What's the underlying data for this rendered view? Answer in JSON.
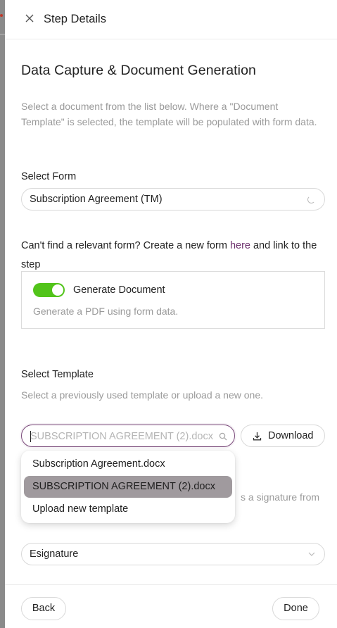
{
  "header": {
    "title": "Step Details",
    "close_icon": "close-icon"
  },
  "main": {
    "title": "Data Capture & Document Generation",
    "description": "Select a document from the list below. Where a \"Document Template\" is selected, the template will be populated with form data."
  },
  "form": {
    "label": "Select Form",
    "value": "Subscription Agreement (TM)",
    "hint_before": "Can't find a relevant form? Create a new form ",
    "hint_link": "here",
    "hint_after": " and link to the step"
  },
  "generate": {
    "label": "Generate Document",
    "sub": "Generate a PDF using form data.",
    "enabled": true,
    "toggle_color": "#52c41a"
  },
  "template": {
    "label": "Select Template",
    "sub": "Select a previously used template or upload a new one.",
    "placeholder": "SUBSCRIPTION AGREEMENT (2).docx",
    "download_label": "Download",
    "options": [
      {
        "label": "Subscription Agreement.docx",
        "selected": false
      },
      {
        "label": "SUBSCRIPTION AGREEMENT (2).docx",
        "selected": true
      },
      {
        "label": "Upload new template",
        "selected": false
      }
    ]
  },
  "signature": {
    "partial_text": "s a signature from",
    "value": "Esignature"
  },
  "footer": {
    "back_label": "Back",
    "done_label": "Done"
  },
  "colors": {
    "accent": "#6b2d6b",
    "selected_option": "#a09a9e"
  }
}
